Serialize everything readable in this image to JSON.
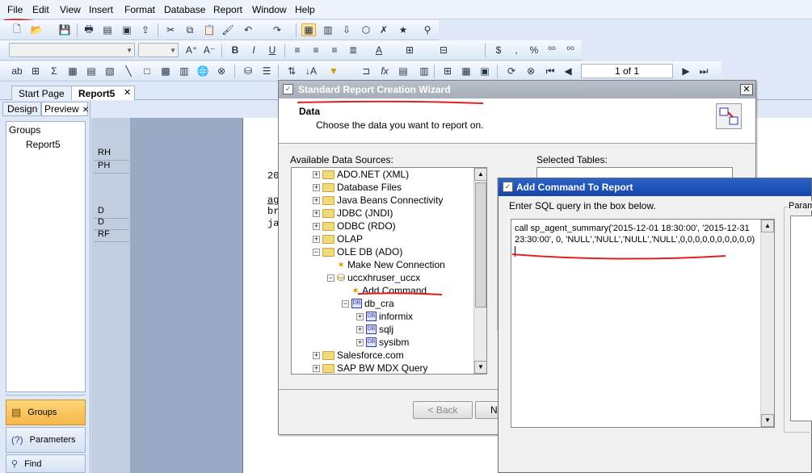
{
  "menu": [
    "File",
    "Edit",
    "View",
    "Insert",
    "Format",
    "Database",
    "Report",
    "Window",
    "Help"
  ],
  "navigation": {
    "page_indicator": "1 of 1"
  },
  "tabs": {
    "start_page": "Start Page",
    "report": "Report5"
  },
  "left_panel": {
    "design_tab": "Design",
    "preview_tab": "Preview",
    "groups_header": "Groups",
    "group_item": "Report5",
    "nav_groups": "Groups",
    "nav_parameters": "Parameters",
    "nav_find": "Find"
  },
  "report": {
    "sections": [
      "RH",
      "PH",
      "D",
      "D",
      "RF"
    ],
    "text_lines": [
      "20",
      "ag",
      "br",
      "ja"
    ]
  },
  "wizard": {
    "title": "Standard Report Creation Wizard",
    "header_title": "Data",
    "header_subtitle": "Choose the data you want to report on.",
    "available_label": "Available Data Sources:",
    "selected_label": "Selected Tables:",
    "tree": [
      {
        "label": "ADO.NET (XML)",
        "indent": 0,
        "expander": "+",
        "icon": "folder-icon"
      },
      {
        "label": "Database Files",
        "indent": 0,
        "expander": "+",
        "icon": "folder-icon"
      },
      {
        "label": "Java Beans Connectivity",
        "indent": 0,
        "expander": "+",
        "icon": "folder-icon"
      },
      {
        "label": "JDBC (JNDI)",
        "indent": 0,
        "expander": "+",
        "icon": "folder-icon"
      },
      {
        "label": "ODBC (RDO)",
        "indent": 0,
        "expander": "+",
        "icon": "folder-icon"
      },
      {
        "label": "OLAP",
        "indent": 0,
        "expander": "+",
        "icon": "folder-icon"
      },
      {
        "label": "OLE DB (ADO)",
        "indent": 0,
        "expander": "−",
        "icon": "folder-icon"
      },
      {
        "label": "Make New Connection",
        "indent": 1,
        "expander": "",
        "icon": "wand-icon"
      },
      {
        "label": "uccxhruser_uccx",
        "indent": 1,
        "expander": "−",
        "icon": "connection-icon"
      },
      {
        "label": "Add Command",
        "indent": 2,
        "expander": "",
        "icon": "wand-icon"
      },
      {
        "label": "db_cra",
        "indent": 2,
        "expander": "−",
        "icon": "database-icon"
      },
      {
        "label": "informix",
        "indent": 3,
        "expander": "+",
        "icon": "database-icon"
      },
      {
        "label": "sqlj",
        "indent": 3,
        "expander": "+",
        "icon": "database-icon"
      },
      {
        "label": "sysibm",
        "indent": 3,
        "expander": "+",
        "icon": "database-icon"
      },
      {
        "label": "Salesforce.com",
        "indent": 0,
        "expander": "+",
        "icon": "folder-icon"
      },
      {
        "label": "SAP BW MDX Query",
        "indent": 0,
        "expander": "+",
        "icon": "folder-icon"
      }
    ],
    "back_button": "< Back",
    "next_button_partial": "N"
  },
  "add_command": {
    "title": "Add Command To Report",
    "instruction": "Enter SQL query in the box below.",
    "sql_line1": "call sp_agent_summary('2015-12-01 18:30:00', '2015-12-31",
    "sql_line2": "23:30:00', 0, 'NULL','NULL','NULL','NULL',0,0,0,0,0,0,0,0,0,0)",
    "param_label_partial": "Param"
  },
  "colors": {
    "annotation_red": "#e02020",
    "dialog_title_blue": "#1c4fb4",
    "wizard_title_gray": "#aab2bd"
  }
}
